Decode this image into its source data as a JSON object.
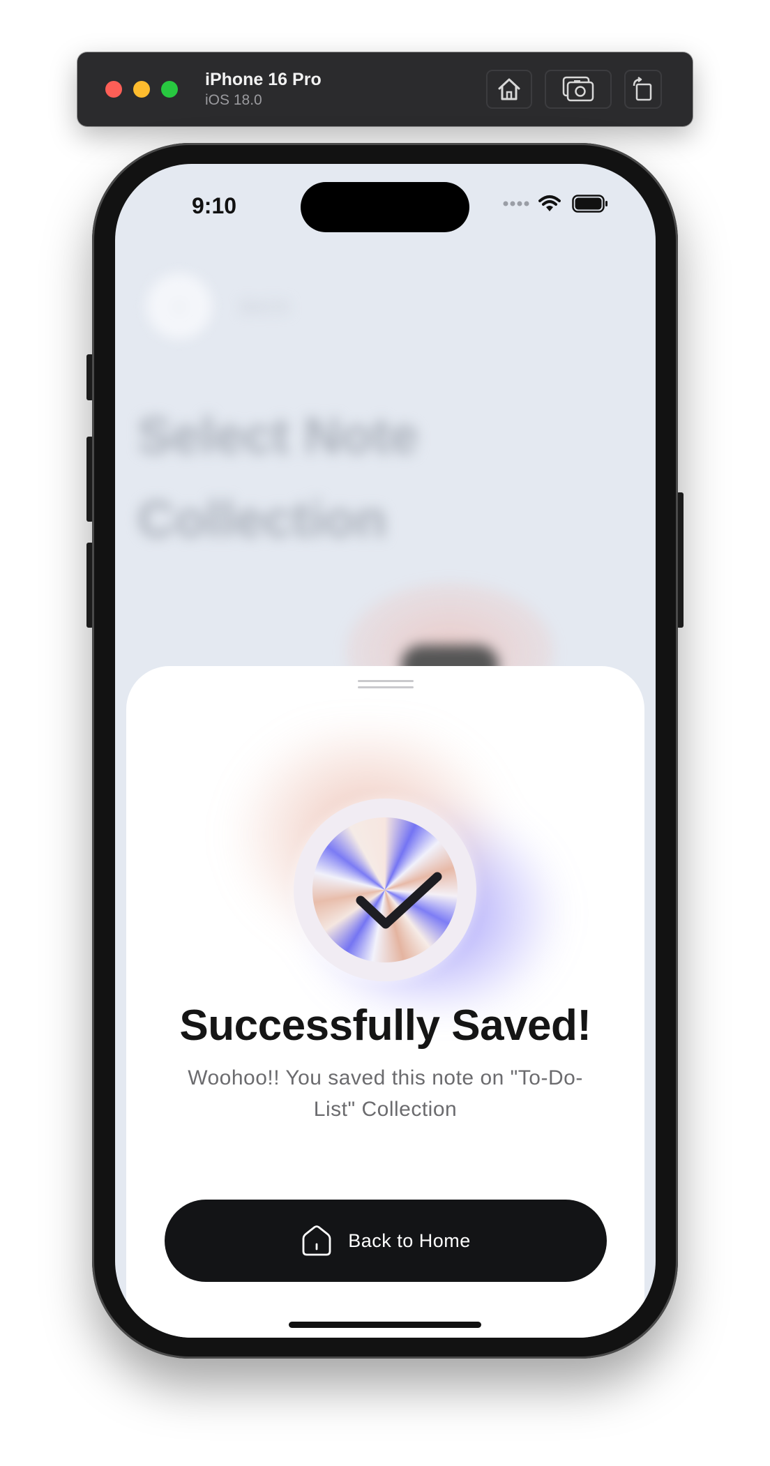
{
  "simulator": {
    "device_name": "iPhone 16 Pro",
    "os_version": "iOS 18.0",
    "toolbar_icons": [
      "home-icon",
      "screenshot-icon",
      "rotate-icon"
    ]
  },
  "status_bar": {
    "time": "9:10",
    "icons": [
      "signal-dots-icon",
      "wifi-icon",
      "battery-icon"
    ]
  },
  "background_page": {
    "back_label": "BACK",
    "title": "Select Note Collection"
  },
  "sheet": {
    "badge_icon": "checkmark-icon",
    "title": "Successfully Saved!",
    "subtitle": "Woohoo!! You saved this note on \"To-Do-List\" Collection",
    "button_label": "Back to Home",
    "button_icon": "home-icon"
  },
  "colors": {
    "button_bg": "#131416",
    "screen_bg": "#e4e9f1",
    "accent_blue": "#7474f3",
    "accent_peach": "#e7b9a7"
  }
}
